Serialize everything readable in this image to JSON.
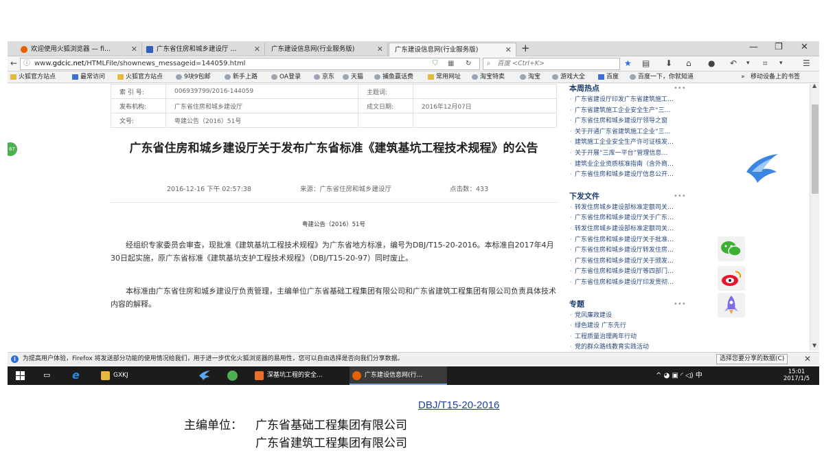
{
  "browser": {
    "tabs": [
      {
        "label": "欢迎使用火狐浏览器 — fi...",
        "icon_color": "#e66000"
      },
      {
        "label": "广东省住房和城乡建设厅 ...",
        "icon_color": "#2b5fb8"
      },
      {
        "label": "广东建设信息网(行业服务版)",
        "icon_color": "#dcdcdc"
      },
      {
        "label": "广东建设信息网(行业服务版)",
        "icon_color": "#f5f5f5"
      }
    ],
    "new_tab": "+",
    "window_controls": [
      "—",
      "❐",
      "✕"
    ],
    "url_prefix": "www.",
    "url_domain": "gdcic.net",
    "url_path": "/HTMLFile/shownews_messageid=144059.html",
    "search_placeholder": "百度 <Ctrl+K>",
    "bookmarks": [
      "火狐官方站点",
      "最常访问",
      "火狐官方站点",
      "9块9包邮",
      "新手上路",
      "OA登录",
      "京东",
      "天猫",
      "捕鱼赢话费",
      "常用网址",
      "淘宝特卖",
      "淘宝",
      "游戏大全",
      "百度",
      "百度一下，你就知道"
    ],
    "bookmarks_right": "移动设备上的书签"
  },
  "article": {
    "info": {
      "index_label": "索 引 号:",
      "index_value": "006939799/2016-144059",
      "subject_label": "主题词:",
      "subject_value": "",
      "org_label": "发布机构:",
      "org_value": "广东省住房和城乡建设厅",
      "date_label": "成文日期:",
      "date_value": "2016年12月07日",
      "docno_label": "文号:",
      "docno_value": "粤建公告（2016）51号"
    },
    "title": "广东省住房和城乡建设厅关于发布广东省标准《建筑基坑工程技术规程》的公告",
    "datetime": "2016-12-16 下午 02:57:38",
    "source": "来源：广东省住房和城乡建设厅",
    "clicks": "点击数：433",
    "doc_number": "粤建公告（2016）51号",
    "para1": "　　经组织专家委员会审查，现批准《建筑基坑工程技术规程》为广东省地方标准，编号为DBJ/T15-20-2016。本标准自2017年4月30日起实施，原广东省标准《建筑基坑支护工程技术规程》（DBJ/T15-20-97）同时废止。",
    "para2": "　　本标准由广东省住房和城乡建设厅负责管理，主编单位广东省基础工程集团有限公司和广东省建筑工程集团有限公司负责具体技术内容的解释。",
    "float_badge": "67"
  },
  "sidebar": {
    "hot": {
      "title": "本周热点",
      "more": "•••",
      "items": [
        "广东省建设厅印发广东省建筑施工…",
        "广东省建筑施工企业安全生产“三…",
        "广东省住房和城乡建设厅领导之窗",
        "关于开通广东省建筑施工企业“三…",
        "建筑施工企业安全生产许可证核发…",
        "关于开展“三库一平台”管理信息…",
        "建筑业企业资质核准指南（含外商…",
        "广东省住房和城乡建设厅信息公开…"
      ]
    },
    "docs": {
      "title": "下发文件",
      "more": "•••",
      "items": [
        "转发住房城乡建设部标准定额司关…",
        "广东省住房和城乡建设厅关于广东…",
        "转发住房城乡建设部标准定额司关…",
        "广东省住房和城乡建设厅关于批准…",
        "广东省住房和城乡建设厅转发住房…",
        "广东省住房和城乡建设厅关于颁发…",
        "广东省住房和城乡建设厅等四部门…",
        "广东省住房和城乡建设厅印发贯彻…"
      ]
    },
    "topics": {
      "title": "专题",
      "more": "•••",
      "items": [
        "党风廉政建设",
        "绿色建设 广东先行",
        "工程质量治理两年行动",
        "党的群众路线教育实践活动"
      ]
    }
  },
  "notification": {
    "icon": "i",
    "text": "为提高用户体验，Firefox 将发送部分功能的使用情况给我们，用于进一步优化火狐浏览器的易用性，您可以自由选择是否向我们分享数据。",
    "button": "选择您要分享的数据(C)",
    "close": "✕"
  },
  "taskbar": {
    "items": [
      {
        "label": "GXKJ",
        "color": "#e7b93a"
      },
      {
        "label": "深基坑工程的安全...",
        "color": "#e8702a"
      },
      {
        "label": "广东建设信息网(行...",
        "color": "#e66000"
      }
    ],
    "tray_text": "^ ◕ ▣ ◜ ◁) 中",
    "time": "15:01",
    "date": "2017/1/5"
  },
  "footer": {
    "code": "DBJ/T15-20-2016",
    "editor_label": "主编单位：",
    "editor1": "广东省基础工程集团有限公司",
    "editor2": "广东省建筑工程集团有限公司"
  }
}
